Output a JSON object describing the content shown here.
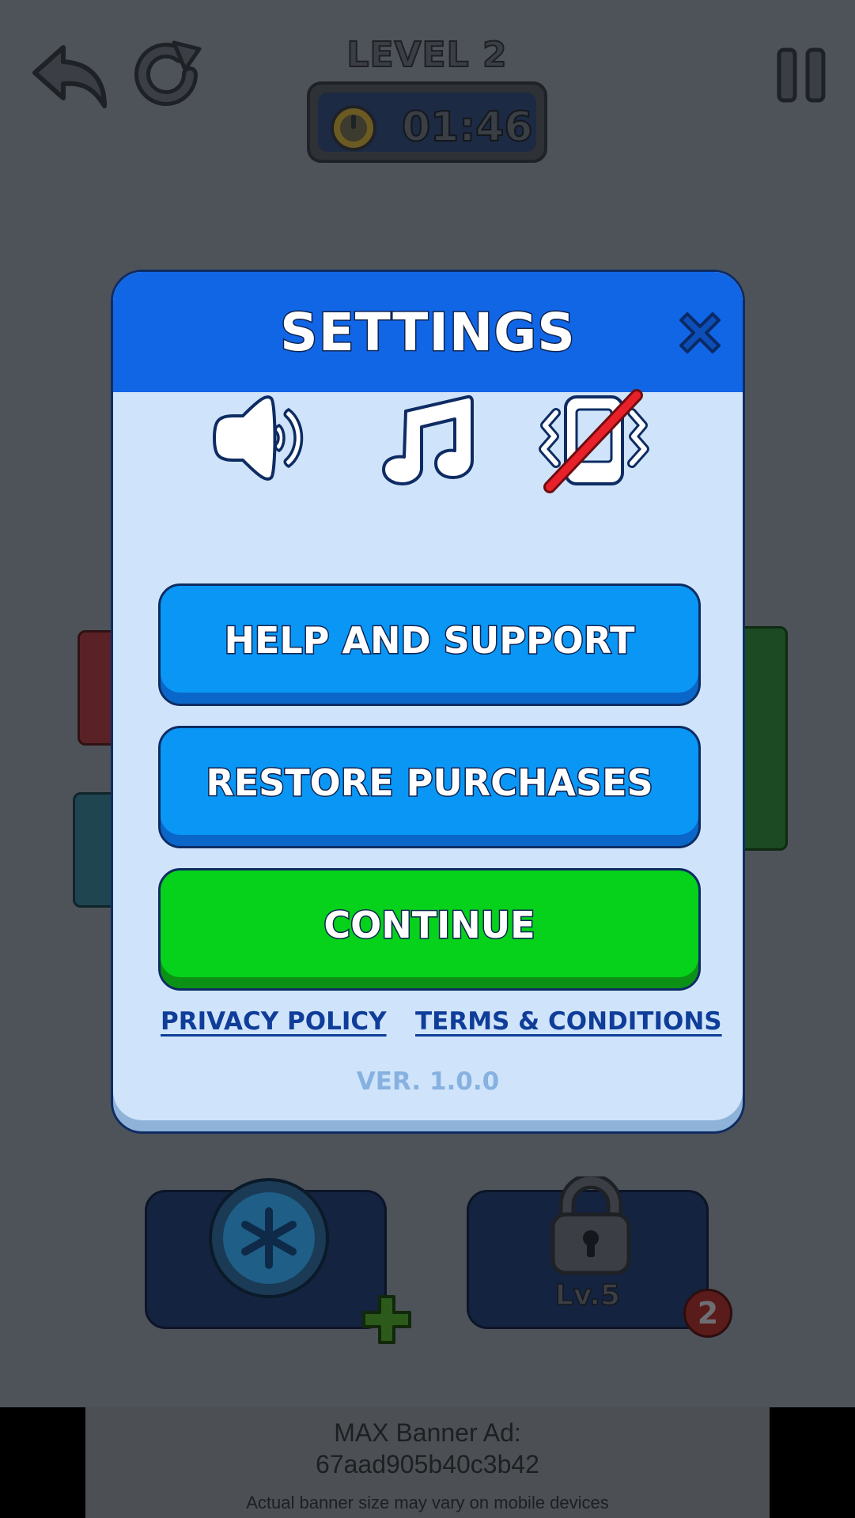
{
  "hud": {
    "level_label": "LEVEL 2",
    "timer_value": "01:46"
  },
  "boosters": [
    {
      "name": "freeze",
      "icon": "snowflake-icon",
      "has_add": true
    },
    {
      "name": "locked",
      "icon": "lock-icon",
      "label": "Lv.5",
      "badge_count": "2"
    }
  ],
  "settings": {
    "title": "SETTINGS",
    "toggles": [
      {
        "name": "sound",
        "icon": "speaker-icon",
        "enabled": true
      },
      {
        "name": "music",
        "icon": "music-note-icon",
        "enabled": true
      },
      {
        "name": "vibration",
        "icon": "vibration-icon",
        "enabled": false
      }
    ],
    "help_label": "HELP AND SUPPORT",
    "restore_label": "RESTORE PURCHASES",
    "continue_label": "CONTINUE",
    "privacy_label": "PRIVACY POLICY",
    "terms_label": "TERMS & CONDITIONS",
    "version": "VER. 1.0.0"
  },
  "ad": {
    "line1": "MAX Banner Ad:",
    "line2": "67aad905b40c3b42",
    "line3": "Actual banner size may vary on mobile devices"
  },
  "colors": {
    "header_blue": "#1166e6",
    "button_blue": "#0a96f5",
    "button_green": "#06d11b",
    "panel_bg": "#cfe4fb",
    "link_blue": "#0f3d99",
    "disabled_slash": "#e8202a"
  }
}
